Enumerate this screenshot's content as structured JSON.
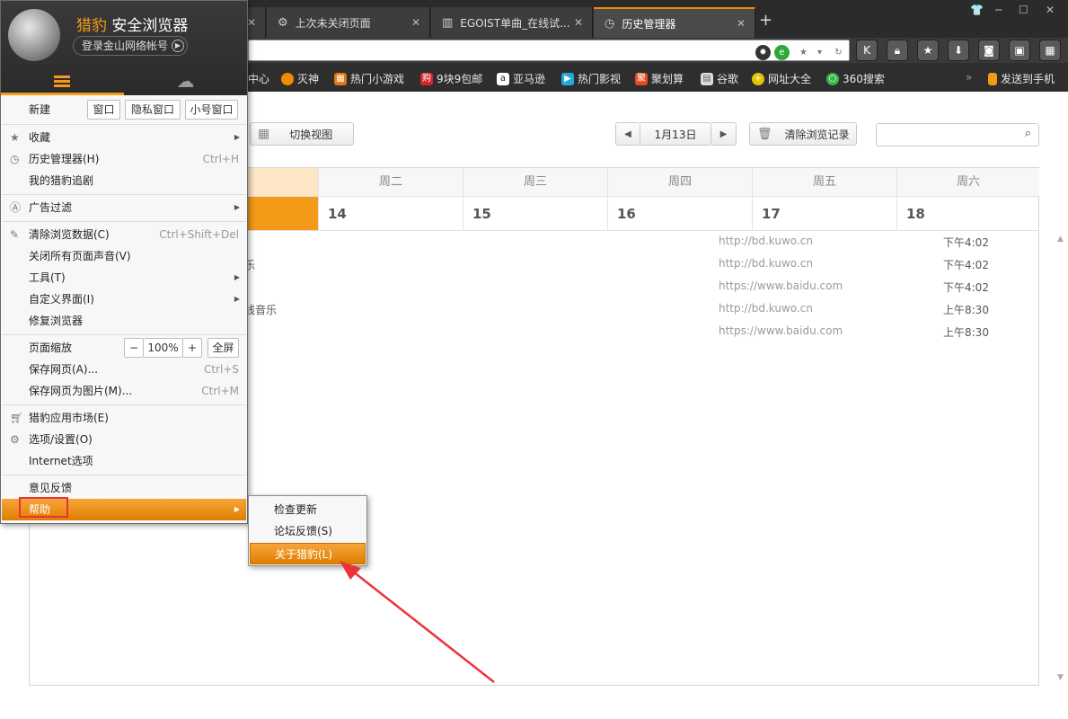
{
  "tabs": [
    {
      "label": "",
      "icon": "gear-icon"
    },
    {
      "label": "上次未关闭页面",
      "icon": "gear-icon"
    },
    {
      "label": "EGOIST单曲_在线试...",
      "icon": "equalizer-icon"
    },
    {
      "label": "历史管理器",
      "icon": "clock-icon",
      "active": true
    }
  ],
  "bookmarks": [
    {
      "label": "中心"
    },
    {
      "label": "灭神",
      "color": "#f08c00"
    },
    {
      "label": "热门小游戏",
      "color": "#e8720c"
    },
    {
      "label": "9块9包邮",
      "color": "#d6242a"
    },
    {
      "label": "亚马逊",
      "color": "#ffffff"
    },
    {
      "label": "热门影视",
      "color": "#21a9e0"
    },
    {
      "label": "聚划算",
      "color": "#e24c1d"
    },
    {
      "label": "谷歌",
      "color": "#cccccc"
    },
    {
      "label": "网址大全",
      "color": "#2da83a"
    },
    {
      "label": "360搜索",
      "color": "#3cb54a"
    },
    {
      "label": "发送到手机",
      "color": "#f39a18"
    }
  ],
  "toolbar": {
    "switch_view": "切换视图",
    "date": "1月13日",
    "clear_history": "清除浏览记录",
    "search_placeholder": ""
  },
  "calendar": {
    "weekdays": [
      "",
      "周二",
      "周三",
      "周四",
      "周五",
      "周六"
    ],
    "days": [
      "",
      "14",
      "15",
      "16",
      "17",
      "18"
    ]
  },
  "history": [
    {
      "title": "",
      "url": "http://bd.kuwo.cn",
      "time": "下午4:02"
    },
    {
      "title": "乐",
      "url": "http://bd.kuwo.cn",
      "time": "下午4:02"
    },
    {
      "title": "",
      "url": "https://www.baidu.com",
      "time": "下午4:02"
    },
    {
      "title": "线音乐",
      "url": "http://bd.kuwo.cn",
      "time": "上午8:30"
    },
    {
      "title": "",
      "url": "https://www.baidu.com",
      "time": "上午8:30"
    }
  ],
  "menu": {
    "brand_accent": "猎豹",
    "brand_rest": " 安全浏览器",
    "login": "登录金山网络帐号",
    "new_label": "新建",
    "new_window": "窗口",
    "new_private": "隐私窗口",
    "new_small": "小号窗口",
    "favorites": "收藏",
    "history_manager": "历史管理器(H)",
    "history_shortcut": "Ctrl+H",
    "my_dramas": "我的猎豹追剧",
    "ad_filter": "广告过滤",
    "clear_data": "清除浏览数据(C)",
    "clear_shortcut": "Ctrl+Shift+Del",
    "mute_all": "关闭所有页面声音(V)",
    "tools": "工具(T)",
    "customize": "自定义界面(I)",
    "repair": "修复浏览器",
    "zoom_label": "页面缩放",
    "zoom_minus": "−",
    "zoom_value": "100%",
    "zoom_plus": "+",
    "fullscreen": "全屏",
    "save_page": "保存网页(A)...",
    "save_shortcut": "Ctrl+S",
    "save_image": "保存网页为图片(M)...",
    "save_image_shortcut": "Ctrl+M",
    "app_market": "猎豹应用市场(E)",
    "options": "选项/设置(O)",
    "internet_options": "Internet选项",
    "feedback": "意见反馈",
    "help": "帮助"
  },
  "submenu": {
    "check_update": "检查更新",
    "forum_feedback": "论坛反馈(S)",
    "about": "关于猎豹(L)"
  },
  "colors": {
    "accent": "#f39a18",
    "annotation": "#e8333a"
  }
}
